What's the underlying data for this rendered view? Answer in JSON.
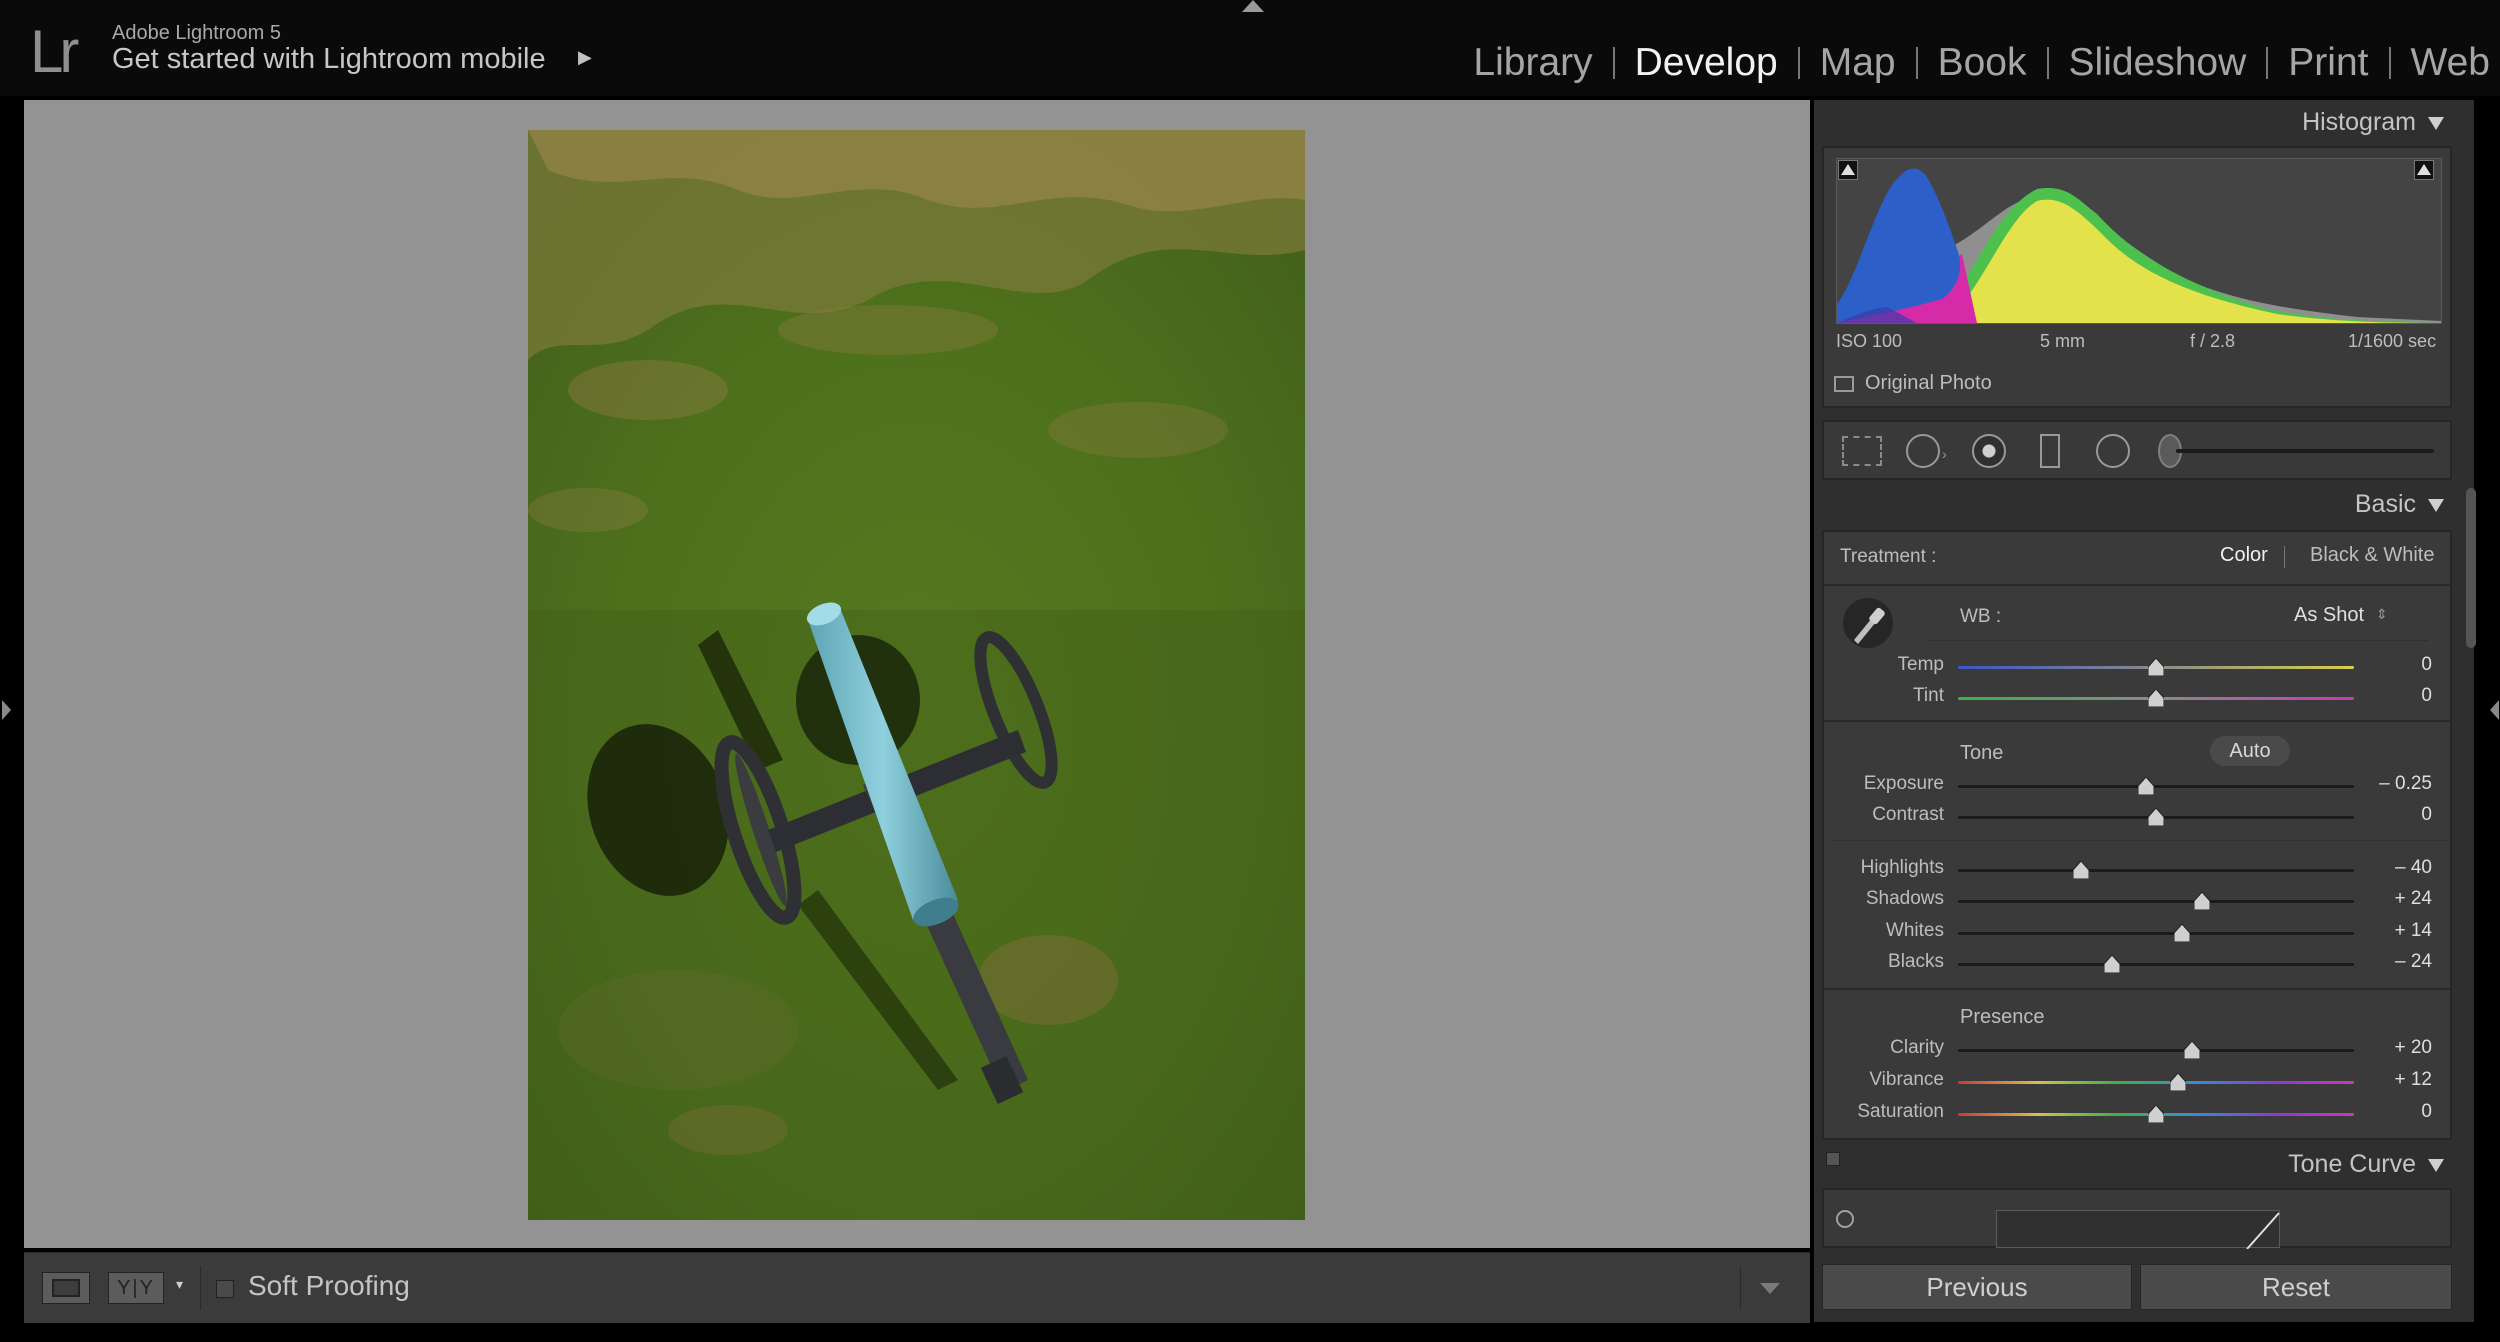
{
  "app": {
    "name": "Adobe Lightroom 5",
    "logo": "Lr",
    "mobile_prompt": "Get started with Lightroom mobile",
    "mobile_arrow": "▶"
  },
  "modules": [
    {
      "label": "Library",
      "active": false
    },
    {
      "label": "Develop",
      "active": true
    },
    {
      "label": "Map",
      "active": false
    },
    {
      "label": "Book",
      "active": false
    },
    {
      "label": "Slideshow",
      "active": false
    },
    {
      "label": "Print",
      "active": false
    },
    {
      "label": "Web",
      "active": false
    }
  ],
  "histogram": {
    "title": "Histogram",
    "iso": "ISO 100",
    "focal": "5 mm",
    "aperture": "f / 2.8",
    "shutter": "1/1600 sec",
    "original_photo": "Original Photo"
  },
  "basic": {
    "title": "Basic",
    "treatment_label": "Treatment :",
    "treatment_color": "Color",
    "treatment_bw": "Black & White",
    "wb_label": "WB :",
    "wb_value": "As Shot",
    "tone_label": "Tone",
    "auto_label": "Auto",
    "presence_label": "Presence",
    "sliders": {
      "temp": {
        "label": "Temp",
        "value": "0",
        "pos": 0.5
      },
      "tint": {
        "label": "Tint",
        "value": "0",
        "pos": 0.5
      },
      "exposure": {
        "label": "Exposure",
        "value": "– 0.25",
        "pos": 0.475
      },
      "contrast": {
        "label": "Contrast",
        "value": "0",
        "pos": 0.5
      },
      "highlights": {
        "label": "Highlights",
        "value": "– 40",
        "pos": 0.31
      },
      "shadows": {
        "label": "Shadows",
        "value": "+ 24",
        "pos": 0.615
      },
      "whites": {
        "label": "Whites",
        "value": "+ 14",
        "pos": 0.565
      },
      "blacks": {
        "label": "Blacks",
        "value": "– 24",
        "pos": 0.39
      },
      "clarity": {
        "label": "Clarity",
        "value": "+ 20",
        "pos": 0.59
      },
      "vibrance": {
        "label": "Vibrance",
        "value": "+ 12",
        "pos": 0.555
      },
      "saturation": {
        "label": "Saturation",
        "value": "0",
        "pos": 0.5
      }
    }
  },
  "tone_curve": {
    "title": "Tone Curve"
  },
  "footer": {
    "previous": "Previous",
    "reset": "Reset"
  },
  "toolbar": {
    "soft_proofing": "Soft Proofing",
    "yy": "Y|Y",
    "dropdown": "▾"
  },
  "colors": {
    "panel_bg": "#2f2f2f",
    "section_bg": "#3a3a3a",
    "center_bg": "#939393",
    "active_module": "#f2f2f2"
  }
}
